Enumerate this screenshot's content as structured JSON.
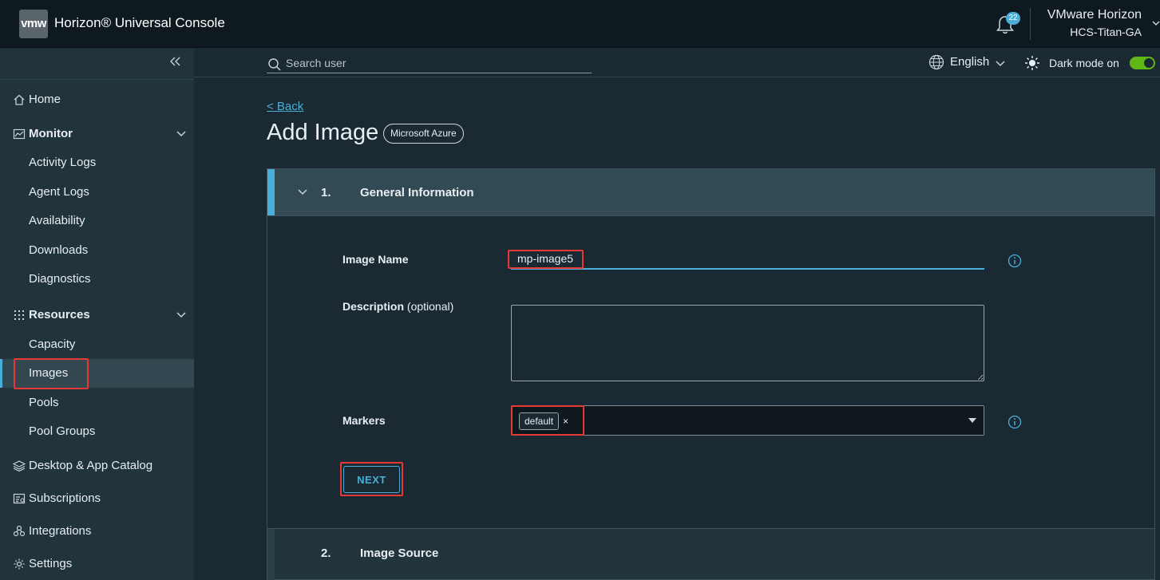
{
  "header": {
    "logo_text": "vmw",
    "app_title": "Horizon® Universal Console",
    "notification_count": "22",
    "org_name": "VMware Horizon",
    "org_sub": "HCS-Titan-GA"
  },
  "toolbar": {
    "search_placeholder": "Search user",
    "language": "English",
    "dark_mode_label": "Dark mode on",
    "dark_mode_on": true
  },
  "sidebar": {
    "home": "Home",
    "monitor": {
      "label": "Monitor",
      "items": [
        "Activity Logs",
        "Agent Logs",
        "Availability",
        "Downloads",
        "Diagnostics"
      ]
    },
    "resources": {
      "label": "Resources",
      "items": [
        "Capacity",
        "Images",
        "Pools",
        "Pool Groups"
      ]
    },
    "active_item": "Images",
    "desktop_app_catalog": "Desktop & App Catalog",
    "subscriptions": "Subscriptions",
    "integrations": "Integrations",
    "settings": "Settings"
  },
  "page": {
    "back_label": "< Back",
    "title": "Add Image",
    "provider_badge": "Microsoft Azure"
  },
  "wizard": {
    "step1": {
      "number": "1.",
      "title": "General Information",
      "image_name_label": "Image Name",
      "image_name_value": "mp-image5",
      "description_label": "Description",
      "description_optional": "(optional)",
      "description_value": "",
      "markers_label": "Markers",
      "markers": [
        "default"
      ],
      "next_label": "NEXT"
    },
    "step2": {
      "number": "2.",
      "title": "Image Source"
    }
  },
  "colors": {
    "accent": "#49afd9",
    "highlight_box": "#e53935",
    "toggle_on": "#5eb715"
  }
}
